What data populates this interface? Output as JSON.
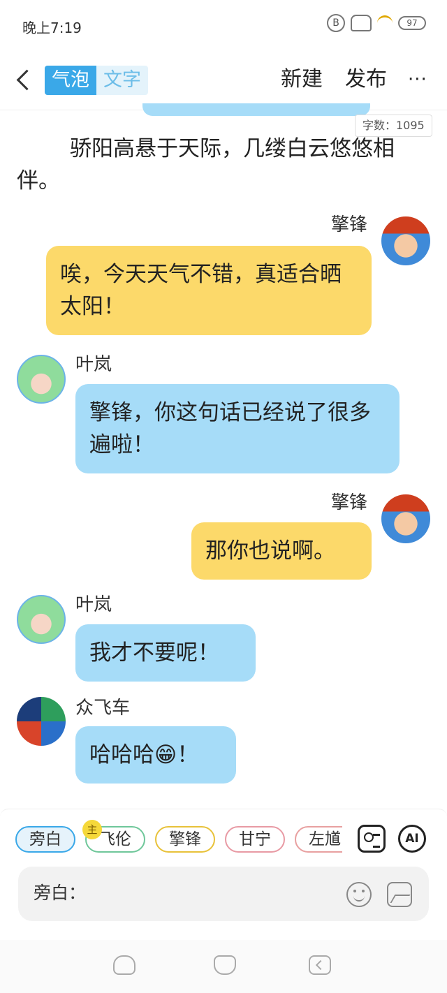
{
  "status_bar": {
    "time": "晚上7:19",
    "icons": [
      "bluetooth-icon",
      "signal-icon",
      "wifi-icon",
      "battery-icon"
    ],
    "bt_glyph": "B",
    "battery_text": "97"
  },
  "header": {
    "mode_bubble": "气泡",
    "mode_text": "文字",
    "new_label": "新建",
    "publish_label": "发布",
    "more_label": "···"
  },
  "word_count": "字数：1095",
  "narration": "骄阳高悬于天际，几缕白云悠悠相伴。",
  "messages": [
    {
      "speaker": "擎锋",
      "text": "唉，今天天气不错，真适合晒太阳！",
      "side": "right",
      "color": "#fcd96a"
    },
    {
      "speaker": "叶岚",
      "text": "擎锋，你这句话已经说了很多遍啦！",
      "side": "left",
      "color": "#a6dcf8"
    },
    {
      "speaker": "擎锋",
      "text": "那你也说啊。",
      "side": "right",
      "color": "#fcd96a"
    },
    {
      "speaker": "叶岚",
      "text": "我才不要呢！",
      "side": "left",
      "color": "#a6dcf8"
    },
    {
      "speaker": "众飞车",
      "text": "哈哈哈😁！",
      "side": "left",
      "color": "#a6dcf8"
    }
  ],
  "characters": {
    "chips": [
      "旁白",
      "飞伦",
      "擎锋",
      "甘宁",
      "左馗"
    ],
    "selected": "旁白",
    "main_badge": "主"
  },
  "input": {
    "label": "旁白：",
    "ai_label": "AI"
  },
  "bottom_nav": [
    "cloud-icon",
    "cat-icon",
    "back-icon"
  ]
}
